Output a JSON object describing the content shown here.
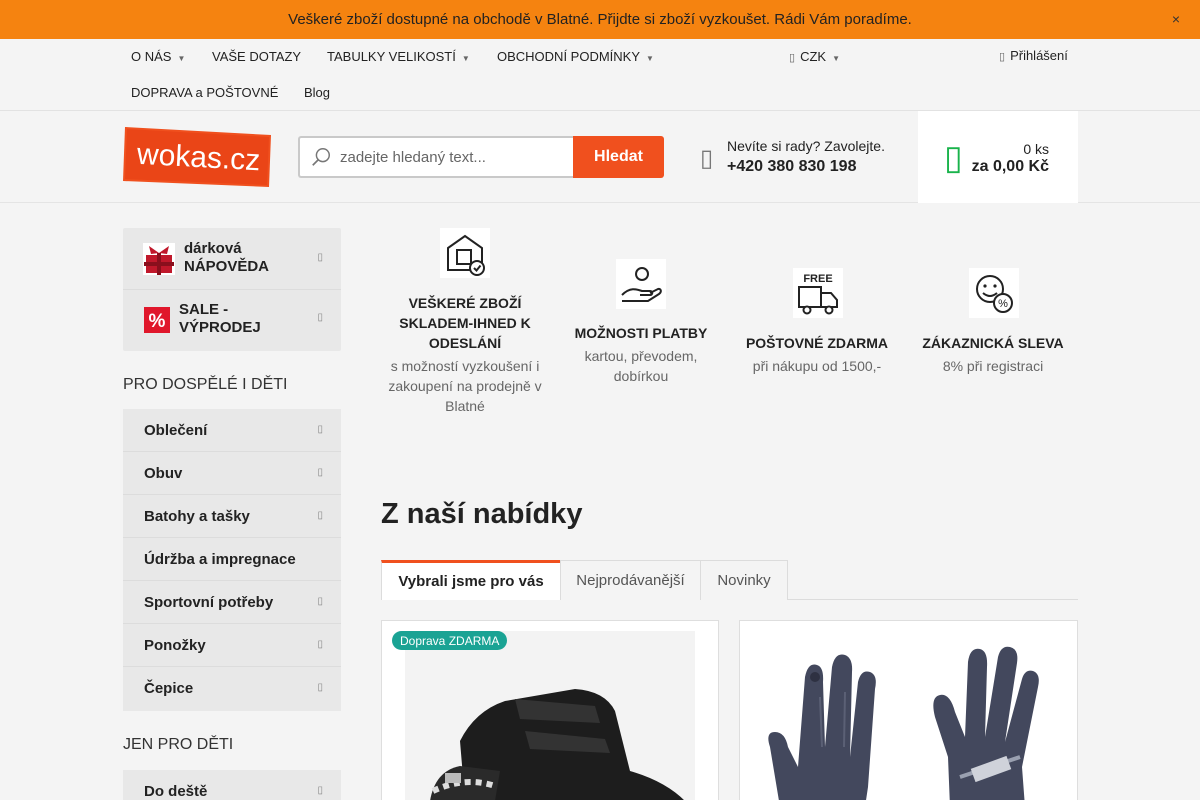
{
  "banner": {
    "text": "Veškeré zboží dostupné na obchodě v Blatné. Přijdte si zboží vyzkoušet. Rádi Vám poradíme.",
    "close": "×"
  },
  "nav": {
    "items": [
      "O NÁS",
      "VAŠE DOTAZY",
      "TABULKY VELIKOSTÍ",
      "OBCHODNÍ PODMÍNKY",
      "DOPRAVA a POŠTOVNÉ",
      "Blog"
    ],
    "currency": "CZK",
    "login": "Přihlášení"
  },
  "header": {
    "logo_text": "wokas.cz",
    "search_placeholder": "zadejte hledaný text...",
    "search_button": "Hledat",
    "phone_question": "Nevíte si rady? Zavolejte.",
    "phone_number": "+420 380 830 198",
    "cart_count": "0 ks",
    "cart_amount": "za 0,00 Kč"
  },
  "sidebar": {
    "top": [
      {
        "label": "dárková NÁPOVĚDA",
        "icon": "gift-icon"
      },
      {
        "label": "SALE - VÝPRODEJ",
        "icon": "percent-icon"
      }
    ],
    "heading1": "PRO DOSPĚLÉ I DĚTI",
    "cats1": [
      "Oblečení",
      "Obuv",
      "Batohy a tašky",
      "Údržba a impregnace",
      "Sportovní potřeby",
      "Ponožky",
      "Čepice"
    ],
    "cats1_has_sub": [
      true,
      true,
      true,
      false,
      true,
      true,
      true
    ],
    "heading2": "JEN PRO DĚTI",
    "cats2": [
      "Do deště"
    ]
  },
  "features": [
    {
      "title": "VEŠKERÉ ZBOŽÍ SKLADEM-IHNED K ODESLÁNÍ",
      "sub": "s možností vyzkoušení i zakoupení na prodejně v Blatné",
      "icon": "house-check-icon"
    },
    {
      "title": "MOŽNOSTI PLATBY",
      "sub": "kartou, převodem, dobírkou",
      "icon": "hand-coin-icon"
    },
    {
      "title": "POŠTOVNÉ ZDARMA",
      "sub": "při nákupu od 1500,-",
      "icon": "free-truck-icon"
    },
    {
      "title": "ZÁKAZNICKÁ SLEVA",
      "sub": "8% při registraci",
      "icon": "smile-percent-icon"
    }
  ],
  "offers": {
    "title": "Z naší nabídky",
    "tabs": [
      "Vybrali jsme pro vás",
      "Nejprodávanější",
      "Novinky"
    ],
    "badge": "Doprava ZDARMA"
  },
  "colors": {
    "accent": "#f0501e",
    "banner": "#f58310",
    "cart": "#19b34b",
    "badge": "#1aa394"
  }
}
